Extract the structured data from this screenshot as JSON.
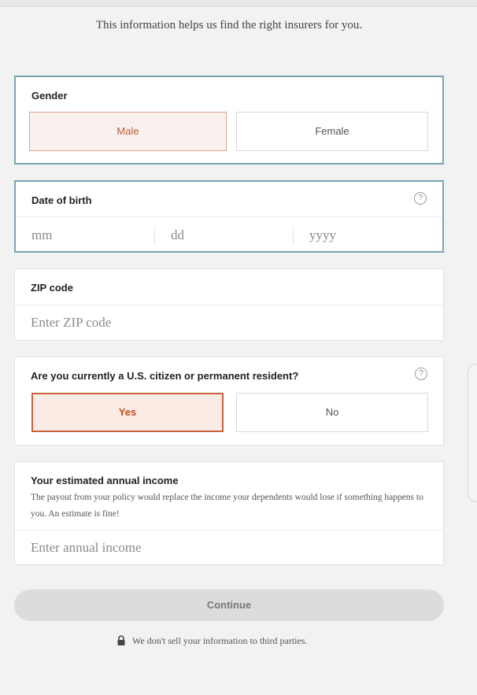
{
  "intro": "This information helps us find the right insurers for you.",
  "gender": {
    "label": "Gender",
    "options": [
      "Male",
      "Female"
    ],
    "selected": "Male"
  },
  "dob": {
    "label": "Date of birth",
    "help": "?",
    "placeholders": [
      "mm",
      "dd",
      "yyyy"
    ]
  },
  "zip": {
    "label": "ZIP code",
    "placeholder": "Enter ZIP code"
  },
  "citizen": {
    "label": "Are you currently a U.S. citizen or permanent resident?",
    "help": "?",
    "options": [
      "Yes",
      "No"
    ],
    "selected": "Yes"
  },
  "income": {
    "label": "Your estimated annual income",
    "desc": "The payout from your policy would replace the income your dependents would lose if something happens to you. An estimate is fine!",
    "placeholder": "Enter annual income"
  },
  "continue_label": "Continue",
  "privacy": "We don't sell your information to third parties.",
  "colors": {
    "accent": "#c8623c",
    "active_border": "#7aa3b3"
  },
  "icons": {
    "help": "question-circle-icon",
    "lock": "lock-icon"
  }
}
